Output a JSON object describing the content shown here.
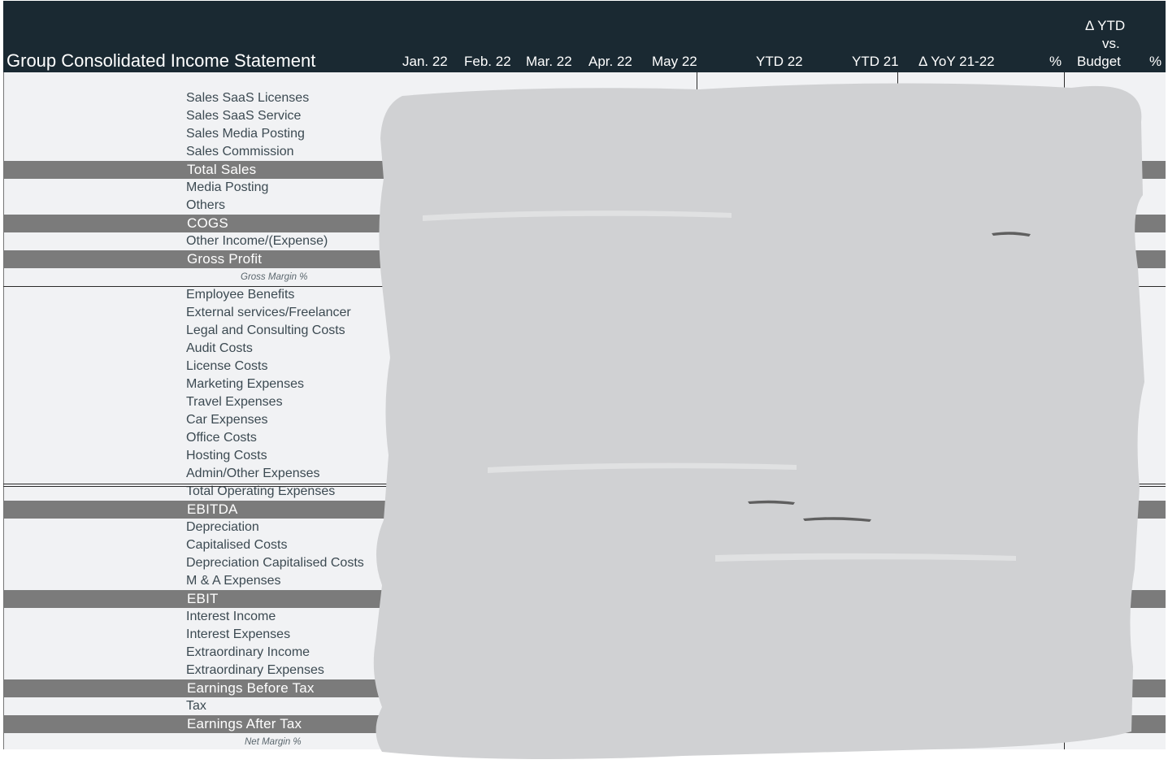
{
  "header": {
    "title": "Group Consolidated Income Statement",
    "columns": [
      "Jan. 22",
      "Feb. 22",
      "Mar. 22",
      "Apr. 22",
      "May 22",
      "YTD 22",
      "YTD 21",
      "Δ YoY 21-22",
      "%",
      "Budget",
      "%"
    ],
    "budget_top": "Δ YTD",
    "budget_mid": "vs."
  },
  "rows": [
    {
      "label": "Sales SaaS Licenses",
      "type": "line"
    },
    {
      "label": "Sales SaaS Service",
      "type": "line"
    },
    {
      "label": "Sales Media Posting",
      "type": "line"
    },
    {
      "label": "Sales Commission",
      "type": "line"
    },
    {
      "label": "Total Sales",
      "type": "total"
    },
    {
      "label": "Media Posting",
      "type": "line"
    },
    {
      "label": "Others",
      "type": "line"
    },
    {
      "label": "COGS",
      "type": "total"
    },
    {
      "label": "Other Income/(Expense)",
      "type": "line"
    },
    {
      "label": "Gross Profit",
      "type": "total"
    },
    {
      "label": "Gross Margin %",
      "type": "italic"
    },
    {
      "label": "Employee Benefits",
      "type": "line"
    },
    {
      "label": "External services/Freelancer",
      "type": "line"
    },
    {
      "label": "Legal and Consulting Costs",
      "type": "line"
    },
    {
      "label": "Audit Costs",
      "type": "line"
    },
    {
      "label": "License Costs",
      "type": "line"
    },
    {
      "label": "Marketing Expenses",
      "type": "line"
    },
    {
      "label": "Travel Expenses",
      "type": "line"
    },
    {
      "label": "Car Expenses",
      "type": "line"
    },
    {
      "label": "Office Costs",
      "type": "line"
    },
    {
      "label": "Hosting Costs",
      "type": "line"
    },
    {
      "label": "Admin/Other Expenses",
      "type": "line"
    },
    {
      "label": "Total Operating Expenses",
      "type": "line"
    },
    {
      "label": "EBITDA",
      "type": "total"
    },
    {
      "label": "Depreciation",
      "type": "line"
    },
    {
      "label": "Capitalised Costs",
      "type": "line"
    },
    {
      "label": "Depreciation Capitalised Costs",
      "type": "line"
    },
    {
      "label": "M & A Expenses",
      "type": "line"
    },
    {
      "label": "EBIT",
      "type": "total"
    },
    {
      "label": "Interest Income",
      "type": "line"
    },
    {
      "label": "Interest Expenses",
      "type": "line"
    },
    {
      "label": "Extraordinary Income",
      "type": "line"
    },
    {
      "label": "Extraordinary Expenses",
      "type": "line"
    },
    {
      "label": "Earnings Before Tax",
      "type": "total"
    },
    {
      "label": "Tax",
      "type": "line"
    },
    {
      "label": "Earnings After Tax",
      "type": "total"
    },
    {
      "label": "Net Margin %",
      "type": "italic"
    }
  ],
  "colors": {
    "header_bg": "#1a2932",
    "sheet_bg": "#f1f2f4",
    "total_row_bg": "#7b7b7b",
    "redaction": "#d0d1d3"
  }
}
